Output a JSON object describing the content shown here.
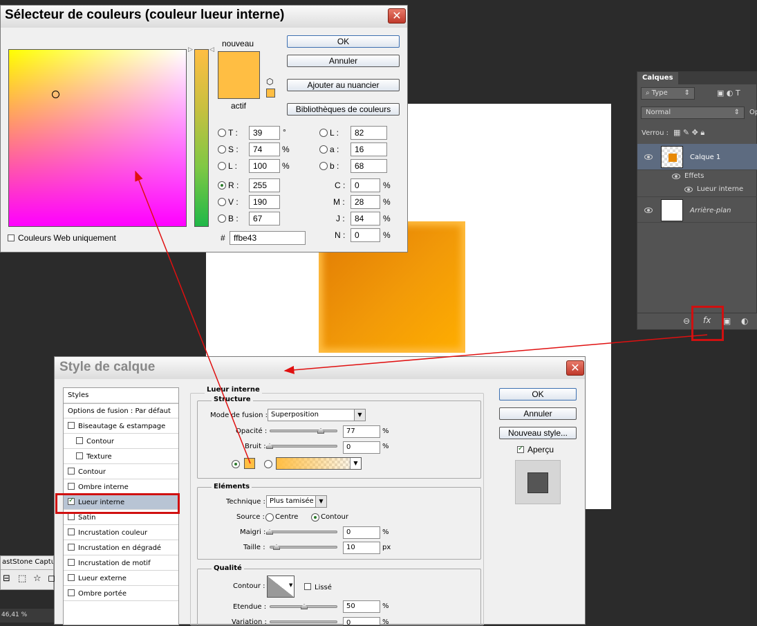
{
  "canvas": {
    "object_color": "#ffbe43"
  },
  "layers_panel": {
    "tab": "Calques",
    "kind_filter": "Type",
    "blend_mode": "Normal",
    "opacity_label": "Op",
    "lock_label": "Verrou :",
    "layers": [
      {
        "name": "Calque 1",
        "effects_label": "Effets",
        "effect": "Lueur interne"
      },
      {
        "name": "Arrière-plan"
      }
    ]
  },
  "picker": {
    "title": "Sélecteur de couleurs (couleur lueur interne)",
    "new_label": "nouveau",
    "current_label": "actif",
    "swatch_color": "#ffbe43",
    "buttons": {
      "ok": "OK",
      "cancel": "Annuler",
      "add_swatch": "Ajouter au nuancier",
      "libraries": "Bibliothèques de couleurs"
    },
    "hsb": [
      {
        "label": "T :",
        "value": "39",
        "unit": "°"
      },
      {
        "label": "S :",
        "value": "74",
        "unit": "%"
      },
      {
        "label": "L :",
        "value": "100",
        "unit": "%"
      }
    ],
    "rgb": [
      {
        "label": "R :",
        "value": "255"
      },
      {
        "label": "V :",
        "value": "190"
      },
      {
        "label": "B :",
        "value": "67"
      }
    ],
    "lab": [
      {
        "label": "L :",
        "value": "82"
      },
      {
        "label": "a :",
        "value": "16"
      },
      {
        "label": "b :",
        "value": "68"
      }
    ],
    "cmyk": [
      {
        "label": "C :",
        "value": "0",
        "unit": "%"
      },
      {
        "label": "M :",
        "value": "28",
        "unit": "%"
      },
      {
        "label": "J :",
        "value": "84",
        "unit": "%"
      },
      {
        "label": "N :",
        "value": "0",
        "unit": "%"
      }
    ],
    "hex_label": "#",
    "hex": "ffbe43",
    "web_only": "Couleurs Web uniquement"
  },
  "style_dialog": {
    "title": "Style de calque",
    "list_header": "Styles",
    "items": [
      "Options de fusion : Par défaut",
      "Biseautage & estampage",
      "Contour",
      "Texture",
      "Contour",
      "Ombre interne",
      "Lueur interne",
      "Satin",
      "Incrustation couleur",
      "Incrustation en dégradé",
      "Incrustation de motif",
      "Lueur externe",
      "Ombre portée"
    ],
    "section_title": "Lueur interne",
    "structure": {
      "title": "Structure",
      "blend_label": "Mode de fusion :",
      "blend_value": "Superposition",
      "opacity_label": "Opacité :",
      "opacity_value": "77",
      "noise_label": "Bruit :",
      "noise_value": "0",
      "unit": "%"
    },
    "elements": {
      "title": "Eléments",
      "technique_label": "Technique :",
      "technique_value": "Plus tamisée",
      "source_label": "Source :",
      "source_center": "Centre",
      "source_edge": "Contour",
      "choke_label": "Maigri :",
      "choke_value": "0",
      "size_label": "Taille :",
      "size_value": "10",
      "px": "px",
      "pct": "%"
    },
    "quality": {
      "title": "Qualité",
      "contour_label": "Contour :",
      "antialias": "Lissé",
      "range_label": "Etendue :",
      "range_value": "50",
      "jitter_label": "Variation :",
      "jitter_value": "0",
      "pct": "%"
    },
    "buttons": {
      "ok": "OK",
      "cancel": "Annuler",
      "new_style": "Nouveau style...",
      "preview": "Aperçu"
    }
  },
  "taskbar": {
    "app": "astStone Captur",
    "zoom": "46,41 %"
  }
}
